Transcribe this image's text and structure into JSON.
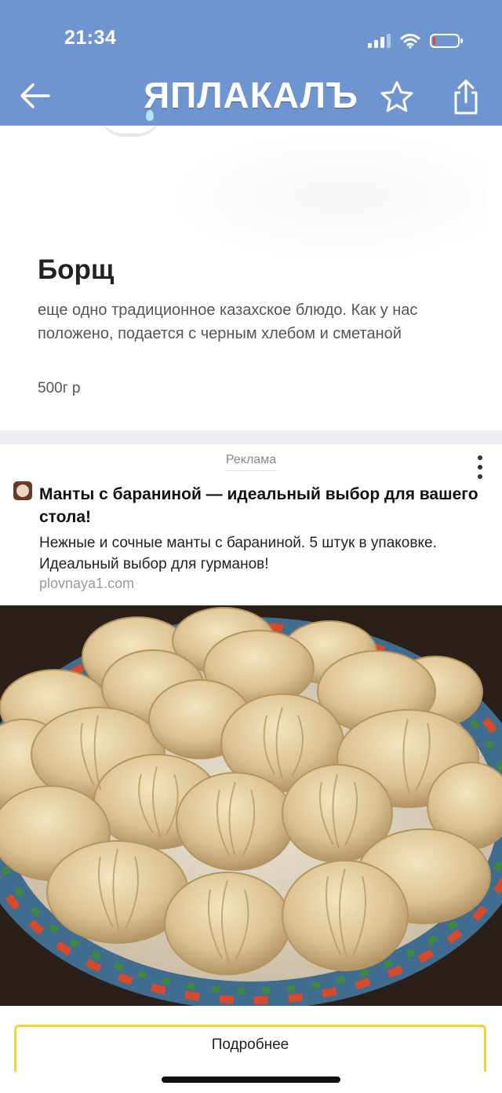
{
  "status_bar": {
    "time": "21:34",
    "battery_level": 0.1,
    "battery_color": "#ff3b30"
  },
  "header": {
    "background": "#6e95cf",
    "logo_text": "ЯПЛАКАЛЪ",
    "back_icon": "arrow-left-icon",
    "favorite_icon": "star-icon",
    "share_icon": "share-icon"
  },
  "menu_item": {
    "title": "Борщ",
    "description": "еще одно традиционное казахское блюдо. Как у нас положено, подается с черным хлебом и сметаной",
    "price": "500г р"
  },
  "ad": {
    "label": "Реклама",
    "title": "Манты с бараниной — идеальный выбор для вашего стола!",
    "text": "Нежные и сочные манты с бараниной. 5 штук в упаковке. Идеальный выбор для гурманов!",
    "domain": "plovnaya1.com",
    "image_subject": "manti dumplings on ornate plate",
    "cta_label": "Подробнее",
    "cta_border_color": "#f5d530"
  }
}
